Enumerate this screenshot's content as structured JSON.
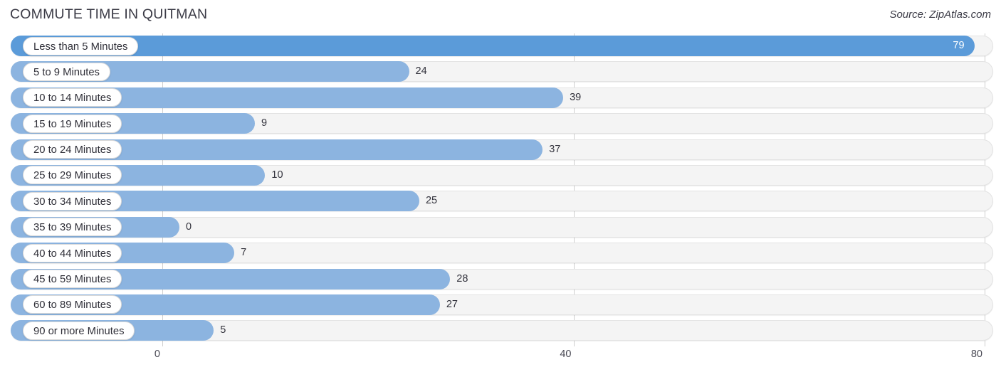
{
  "header": {
    "title": "COMMUTE TIME IN QUITMAN",
    "source": "Source: ZipAtlas.com"
  },
  "colors": {
    "bar_primary": "#5b9bd9",
    "bar_default": "#8cb4e0",
    "track": "#f4f4f4",
    "gridline": "#cfcfcf",
    "text": "#33333d"
  },
  "chart_data": {
    "type": "bar",
    "orientation": "horizontal",
    "title": "COMMUTE TIME IN QUITMAN",
    "xlabel": "",
    "ylabel": "",
    "xlim": [
      0,
      80
    ],
    "xticks": [
      0,
      40,
      80
    ],
    "xtick_labels": [
      "0",
      "40",
      "80"
    ],
    "grid": true,
    "legend": false,
    "categories": [
      "Less than 5 Minutes",
      "5 to 9 Minutes",
      "10 to 14 Minutes",
      "15 to 19 Minutes",
      "20 to 24 Minutes",
      "25 to 29 Minutes",
      "30 to 34 Minutes",
      "35 to 39 Minutes",
      "40 to 44 Minutes",
      "45 to 59 Minutes",
      "60 to 89 Minutes",
      "90 or more Minutes"
    ],
    "values": [
      79,
      24,
      39,
      9,
      37,
      10,
      25,
      0,
      7,
      28,
      27,
      5
    ],
    "value_labels": [
      "79",
      "24",
      "39",
      "9",
      "37",
      "10",
      "25",
      "0",
      "7",
      "28",
      "27",
      "5"
    ],
    "highlight_index": 0
  }
}
